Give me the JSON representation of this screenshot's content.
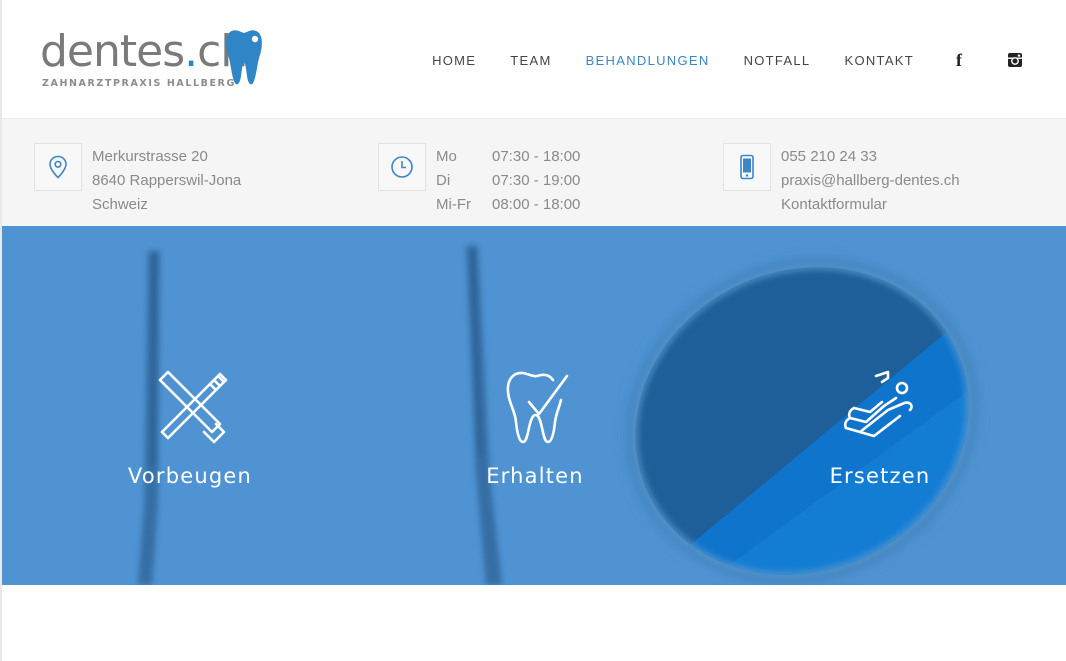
{
  "brand": {
    "name_main": "dentes",
    "name_dot": ".",
    "name_tld": "ch",
    "tagline": "ZAHNARZTPRAXIS HALLBERG",
    "accent": "#2f86c6"
  },
  "nav": {
    "items": [
      {
        "label": "HOME",
        "active": false
      },
      {
        "label": "TEAM",
        "active": false
      },
      {
        "label": "BEHANDLUNGEN",
        "active": true
      },
      {
        "label": "NOTFALL",
        "active": false
      },
      {
        "label": "KONTAKT",
        "active": false
      }
    ],
    "facebook_glyph": "f",
    "social_icons": [
      "facebook-icon",
      "instagram-icon"
    ]
  },
  "address": {
    "icon": "location-pin-icon",
    "street": "Merkurstrasse 20",
    "city": "8640 Rapperswil-Jona",
    "country": "Schweiz"
  },
  "hours": {
    "icon": "clock-icon",
    "rows": [
      {
        "day": "Mo",
        "time": "07:30 - 18:00"
      },
      {
        "day": "Di",
        "time": "07:30 - 19:00"
      },
      {
        "day": "Mi-Fr",
        "time": "08:00 - 18:00"
      }
    ]
  },
  "contact": {
    "icon": "mobile-phone-icon",
    "phone": "055 210 24 33",
    "email": "praxis@hallberg-dentes.ch",
    "form_link": "Kontaktformular"
  },
  "hero": {
    "background_color": "#4a8fcf",
    "features": [
      {
        "label": "Vorbeugen",
        "icon": "toothbrush-toothpaste-icon"
      },
      {
        "label": "Erhalten",
        "icon": "tooth-check-icon"
      },
      {
        "label": "Ersetzen",
        "icon": "dental-chair-icon"
      }
    ]
  }
}
